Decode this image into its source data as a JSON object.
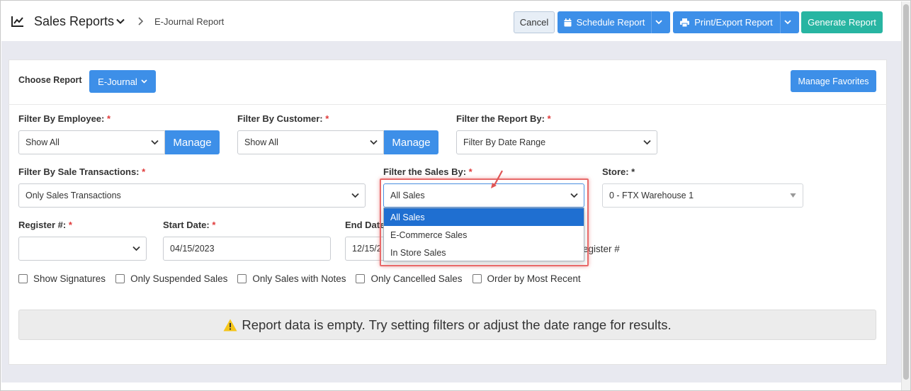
{
  "header": {
    "title": "Sales Reports",
    "breadcrumb": "E-Journal Report",
    "cancel_label": "Cancel",
    "schedule_label": "Schedule Report",
    "print_label": "Print/Export Report",
    "generate_label": "Generate Report"
  },
  "choose_report": {
    "label": "Choose Report",
    "value": "E-Journal",
    "manage_favorites": "Manage Favorites"
  },
  "filters": {
    "employee": {
      "label": "Filter By Employee:",
      "req": "*",
      "value": "Show All",
      "manage": "Manage"
    },
    "customer": {
      "label": "Filter By Customer:",
      "req": "*",
      "value": "Show All",
      "manage": "Manage"
    },
    "report_by": {
      "label": "Filter the Report By:",
      "req": "*",
      "value": "Filter By Date Range"
    },
    "transactions": {
      "label": "Filter By Sale Transactions:",
      "req": "*",
      "value": "Only Sales Transactions"
    },
    "sales_by": {
      "label": "Filter the Sales By:",
      "req": "*",
      "value": "All Sales",
      "options": [
        "All Sales",
        "E-Commerce Sales",
        "In Store Sales"
      ]
    },
    "store": {
      "label": "Store: *",
      "value": "0 - FTX Warehouse 1"
    },
    "register": {
      "label": "Register #:",
      "req": "*",
      "value": ""
    },
    "start_date": {
      "label": "Start Date:",
      "req": "*",
      "value": "04/15/2023"
    },
    "end_date": {
      "label": "End Date",
      "value": "12/15/2"
    },
    "register_hint": "egister #"
  },
  "checkboxes": [
    "Show Signatures",
    "Only Suspended Sales",
    "Only Sales with Notes",
    "Only Cancelled Sales",
    "Order by Most Recent"
  ],
  "alert": "Report data is empty. Try setting filters or adjust the date range for results.",
  "colors": {
    "primary": "#3d8fe8",
    "generate": "#28b5a2",
    "required": "#e03b3b",
    "highlight": "#e86a6a",
    "selected_option": "#1f6fd1"
  }
}
